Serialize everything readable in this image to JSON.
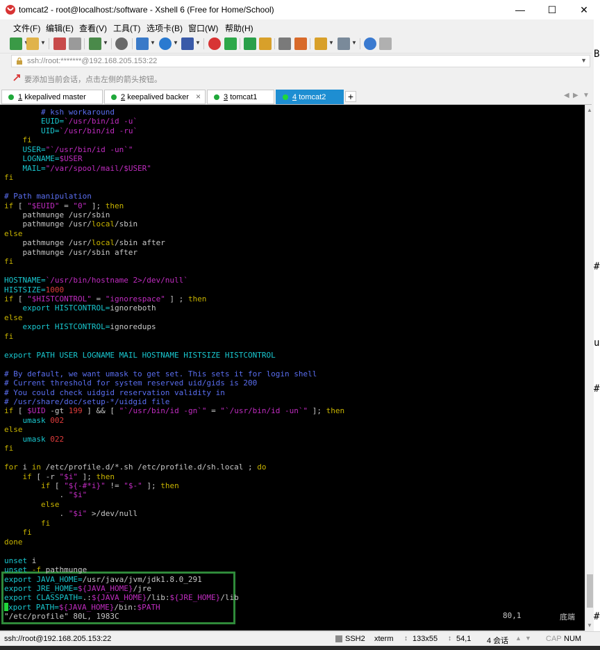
{
  "window": {
    "title": "tomcat2 - root@localhost:/software - Xshell 6 (Free for Home/School)",
    "controls": {
      "minimize": "—",
      "maximize": "☐",
      "close": "✕"
    }
  },
  "menu": [
    "文件(F)",
    "编辑(E)",
    "查看(V)",
    "工具(T)",
    "选项卡(B)",
    "窗口(W)",
    "帮助(H)"
  ],
  "address": {
    "value": "ssh://root:*******@192.168.205.153:22"
  },
  "hint": "要添加当前会话，点击左侧的箭头按钮。",
  "tabs": [
    {
      "num": "1",
      "label": "kkepalived master",
      "active": false
    },
    {
      "num": "2",
      "label": "keepalived backer",
      "active": false
    },
    {
      "num": "3",
      "label": "tomcat1",
      "active": false
    },
    {
      "num": "4",
      "label": "tomcat2",
      "active": true
    }
  ],
  "tab_nav": {
    "prev": "◀",
    "next": "▶",
    "menu": "▼"
  },
  "terminal": {
    "lines": [
      [
        [
          "        # ksh workaround",
          "cmt"
        ]
      ],
      [
        [
          "        EUID=",
          "cyan"
        ],
        [
          "`/usr/bin/id -u`",
          "str"
        ]
      ],
      [
        [
          "        UID=",
          "cyan"
        ],
        [
          "`/usr/bin/id -ru`",
          "str"
        ]
      ],
      [
        [
          "    fi",
          "kw"
        ]
      ],
      [
        [
          "    USER=",
          "cyan"
        ],
        [
          "\"`/usr/bin/id -un`\"",
          "str"
        ]
      ],
      [
        [
          "    LOGNAME=",
          "cyan"
        ],
        [
          "$USER",
          "var"
        ]
      ],
      [
        [
          "    MAIL=",
          "cyan"
        ],
        [
          "\"/var/spool/mail/$USER\"",
          "str"
        ]
      ],
      [
        [
          "fi",
          "kw"
        ]
      ],
      [
        [
          "",
          "def"
        ]
      ],
      [
        [
          "# Path manipulation",
          "cmt"
        ]
      ],
      [
        [
          "if",
          "kw"
        ],
        [
          " [ ",
          "def"
        ],
        [
          "\"$EUID\"",
          "str"
        ],
        [
          " = ",
          "def"
        ],
        [
          "\"0\"",
          "str"
        ],
        [
          " ]; ",
          "def"
        ],
        [
          "then",
          "kw"
        ]
      ],
      [
        [
          "    pathmunge /usr/sbin",
          "def"
        ]
      ],
      [
        [
          "    pathmunge /usr/",
          "def"
        ],
        [
          "local",
          "kw"
        ],
        [
          "/sbin",
          "def"
        ]
      ],
      [
        [
          "else",
          "kw"
        ]
      ],
      [
        [
          "    pathmunge /usr/",
          "def"
        ],
        [
          "local",
          "kw"
        ],
        [
          "/sbin after",
          "def"
        ]
      ],
      [
        [
          "    pathmunge /usr/sbin after",
          "def"
        ]
      ],
      [
        [
          "fi",
          "kw"
        ]
      ],
      [
        [
          "",
          "def"
        ]
      ],
      [
        [
          "HOSTNAME=",
          "cyan"
        ],
        [
          "`/usr/bin/hostname 2>/dev/null`",
          "str"
        ]
      ],
      [
        [
          "HISTSIZE=",
          "cyan"
        ],
        [
          "1000",
          "num"
        ]
      ],
      [
        [
          "if",
          "kw"
        ],
        [
          " [ ",
          "def"
        ],
        [
          "\"$HISTCONTROL\"",
          "str"
        ],
        [
          " = ",
          "def"
        ],
        [
          "\"ignorespace\"",
          "str"
        ],
        [
          " ] ; ",
          "def"
        ],
        [
          "then",
          "kw"
        ]
      ],
      [
        [
          "    export ",
          "cyan"
        ],
        [
          "HISTCONTROL=",
          "cyan"
        ],
        [
          "ignoreboth",
          "def"
        ]
      ],
      [
        [
          "else",
          "kw"
        ]
      ],
      [
        [
          "    export ",
          "cyan"
        ],
        [
          "HISTCONTROL=",
          "cyan"
        ],
        [
          "ignoredups",
          "def"
        ]
      ],
      [
        [
          "fi",
          "kw"
        ]
      ],
      [
        [
          "",
          "def"
        ]
      ],
      [
        [
          "export PATH USER LOGNAME MAIL HOSTNAME HISTSIZE HISTCONTROL",
          "cyan"
        ]
      ],
      [
        [
          "",
          "def"
        ]
      ],
      [
        [
          "# By default, we want umask to get set. This sets it for login shell",
          "cmt"
        ]
      ],
      [
        [
          "# Current threshold for system reserved uid/gids is 200",
          "cmt"
        ]
      ],
      [
        [
          "# You could check uidgid reservation validity in",
          "cmt"
        ]
      ],
      [
        [
          "# /usr/share/doc/setup-*/uidgid file",
          "cmt"
        ]
      ],
      [
        [
          "if",
          "kw"
        ],
        [
          " [ ",
          "def"
        ],
        [
          "$UID",
          "var"
        ],
        [
          " -gt ",
          "def"
        ],
        [
          "199",
          "num"
        ],
        [
          " ] && [ ",
          "def"
        ],
        [
          "\"`/usr/bin/id -gn`\"",
          "str"
        ],
        [
          " = ",
          "def"
        ],
        [
          "\"`/usr/bin/id -un`\"",
          "str"
        ],
        [
          " ]; ",
          "def"
        ],
        [
          "then",
          "kw"
        ]
      ],
      [
        [
          "    umask ",
          "cyan"
        ],
        [
          "002",
          "num"
        ]
      ],
      [
        [
          "else",
          "kw"
        ]
      ],
      [
        [
          "    umask ",
          "cyan"
        ],
        [
          "022",
          "num"
        ]
      ],
      [
        [
          "fi",
          "kw"
        ]
      ],
      [
        [
          "",
          "def"
        ]
      ],
      [
        [
          "for",
          "kw"
        ],
        [
          " i ",
          "def"
        ],
        [
          "in",
          "kw"
        ],
        [
          " /etc/profile.d/*.sh /etc/profile.d/sh.local ; ",
          "def"
        ],
        [
          "do",
          "kw"
        ]
      ],
      [
        [
          "    if",
          "kw"
        ],
        [
          " [ -r ",
          "def"
        ],
        [
          "\"$i\"",
          "str"
        ],
        [
          " ]; ",
          "def"
        ],
        [
          "then",
          "kw"
        ]
      ],
      [
        [
          "        if",
          "kw"
        ],
        [
          " [ ",
          "def"
        ],
        [
          "\"${-#*i}\"",
          "str"
        ],
        [
          " != ",
          "def"
        ],
        [
          "\"$-\"",
          "str"
        ],
        [
          " ]; ",
          "def"
        ],
        [
          "then",
          "kw"
        ]
      ],
      [
        [
          "            . ",
          "def"
        ],
        [
          "\"$i\"",
          "str"
        ]
      ],
      [
        [
          "        else",
          "kw"
        ]
      ],
      [
        [
          "            . ",
          "def"
        ],
        [
          "\"$i\"",
          "str"
        ],
        [
          " >/dev/null",
          "def"
        ]
      ],
      [
        [
          "        fi",
          "kw"
        ]
      ],
      [
        [
          "    fi",
          "kw"
        ]
      ],
      [
        [
          "done",
          "kw"
        ]
      ],
      [
        [
          "",
          "def"
        ]
      ],
      [
        [
          "unset ",
          "cyan"
        ],
        [
          "i",
          "def"
        ]
      ],
      [
        [
          "unset ",
          "cyan"
        ],
        [
          "-f ",
          "kw"
        ],
        [
          "pathmunge",
          "def"
        ]
      ],
      [
        [
          "export ",
          "cyan"
        ],
        [
          "JAVA_HOME=",
          "cyan"
        ],
        [
          "/usr/java/jvm/jdk1.8.0_291",
          "def"
        ]
      ],
      [
        [
          "export ",
          "cyan"
        ],
        [
          "JRE_HOME=",
          "cyan"
        ],
        [
          "${JAVA_HOME}",
          "var"
        ],
        [
          "/jre",
          "def"
        ]
      ],
      [
        [
          "export ",
          "cyan"
        ],
        [
          "CLASSPATH=",
          "cyan"
        ],
        [
          ".:",
          "def"
        ],
        [
          "${JAVA_HOME}",
          "var"
        ],
        [
          "/lib:",
          "def"
        ],
        [
          "${JRE_HOME}",
          "var"
        ],
        [
          "/lib",
          "def"
        ]
      ],
      [
        [
          "CURSOR",
          "cursor"
        ],
        [
          "xport ",
          "cyan"
        ],
        [
          "PATH=",
          "cyan"
        ],
        [
          "${JAVA_HOME}",
          "var"
        ],
        [
          "/bin:",
          "def"
        ],
        [
          "$PATH",
          "var"
        ]
      ],
      [
        [
          "\"/etc/profile\" 80L, 1983C",
          "def"
        ]
      ]
    ],
    "position": "80,1",
    "scroll_label": "底端"
  },
  "statusbar": {
    "connection": "ssh://root@192.168.205.153:22",
    "protocol": "SSH2",
    "term": "xterm",
    "size": "133x55",
    "cursor": "54,1",
    "sessions": "4 会话",
    "cap": "CAP",
    "num": "NUM"
  },
  "colors": {
    "tab_active": "#1e8ed2",
    "highlight": "#2f8a3a",
    "terminal_bg": "#000000"
  }
}
